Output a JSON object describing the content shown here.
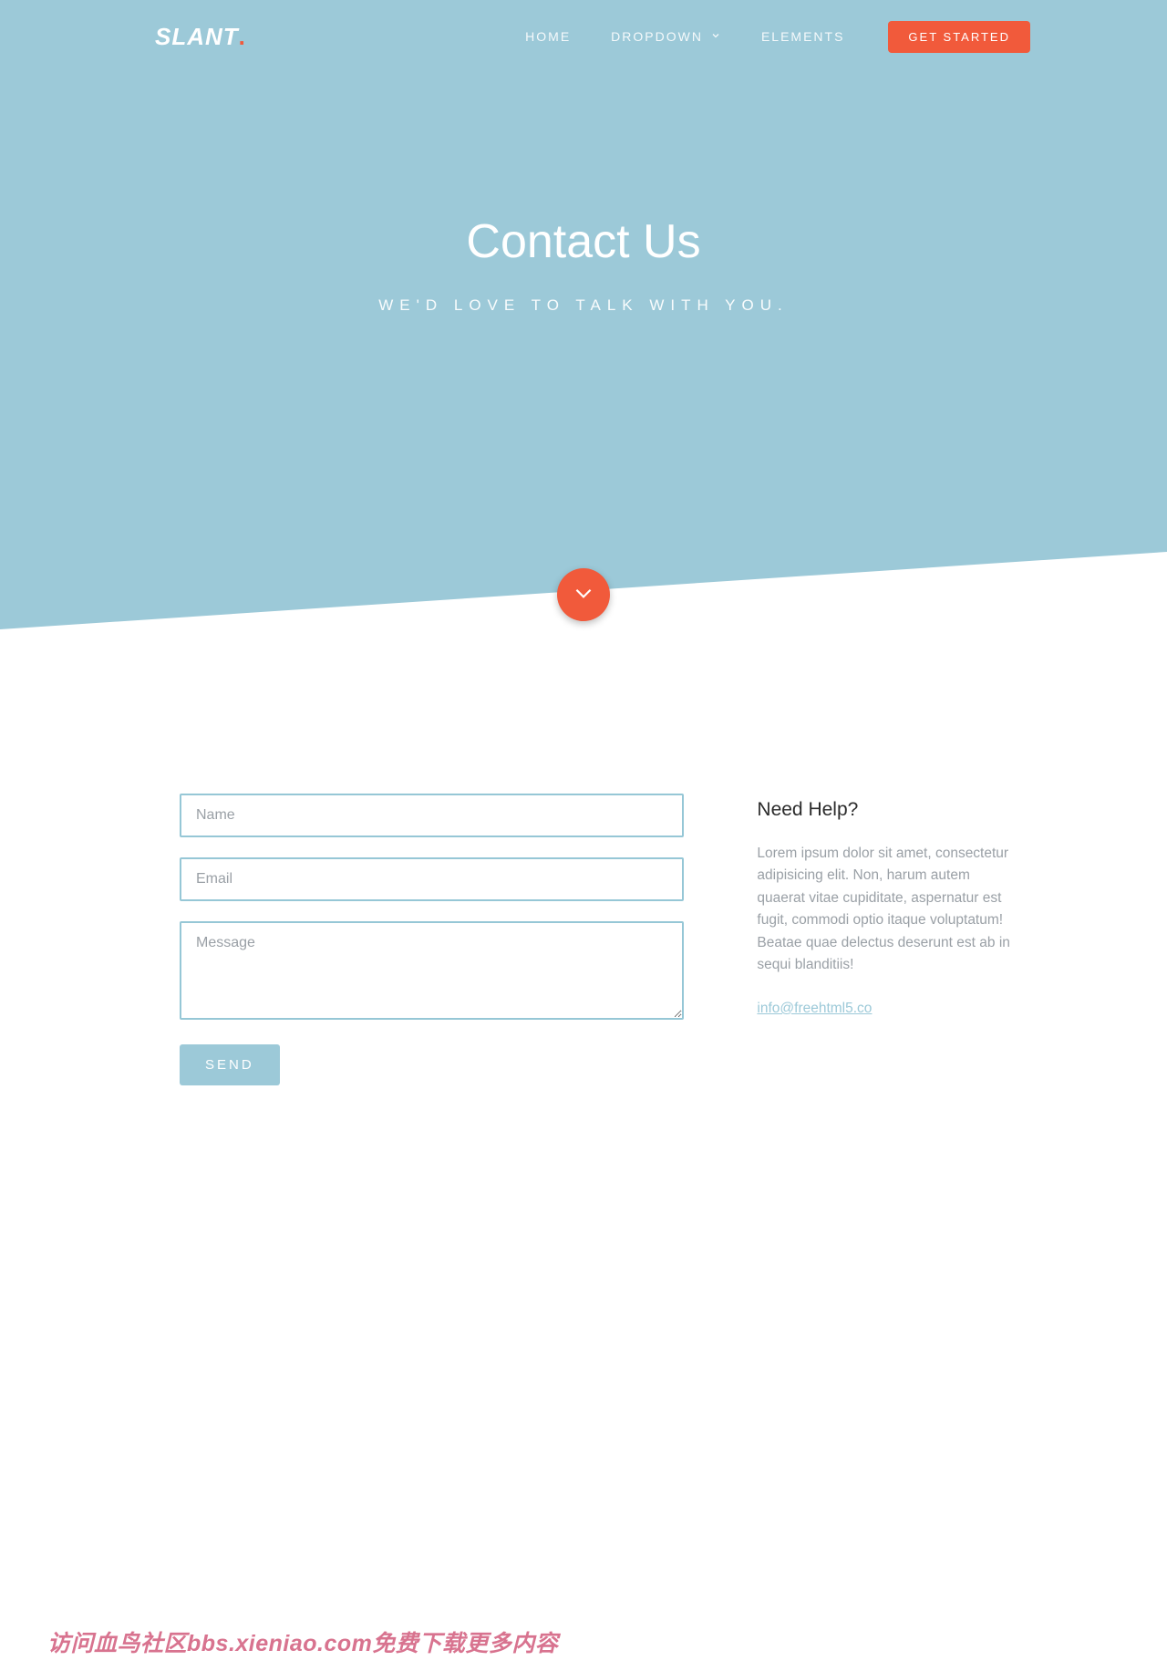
{
  "brand": {
    "name": "SLANT",
    "dot": "."
  },
  "nav": {
    "items": [
      {
        "label": "HOME"
      },
      {
        "label": "DROPDOWN"
      },
      {
        "label": "ELEMENTS"
      }
    ],
    "cta": "GET STARTED"
  },
  "hero": {
    "title": "Contact Us",
    "subtitle": "WE'D LOVE TO TALK WITH YOU."
  },
  "form": {
    "name_placeholder": "Name",
    "email_placeholder": "Email",
    "message_placeholder": "Message",
    "submit": "SEND"
  },
  "sidebar": {
    "title": "Need Help?",
    "body": "Lorem ipsum dolor sit amet, consectetur adipisicing elit. Non, harum autem quaerat vitae cupiditate, aspernatur est fugit, commodi optio itaque voluptatum! Beatae quae delectus deserunt est ab in sequi blanditiis!",
    "email": "info@freehtml5.co"
  },
  "watermark": "访问血鸟社区bbs.xieniao.com免费下载更多内容",
  "colors": {
    "hero_bg": "#9CC9D8",
    "accent": "#F15A3B",
    "input_border": "#96C7D6"
  }
}
